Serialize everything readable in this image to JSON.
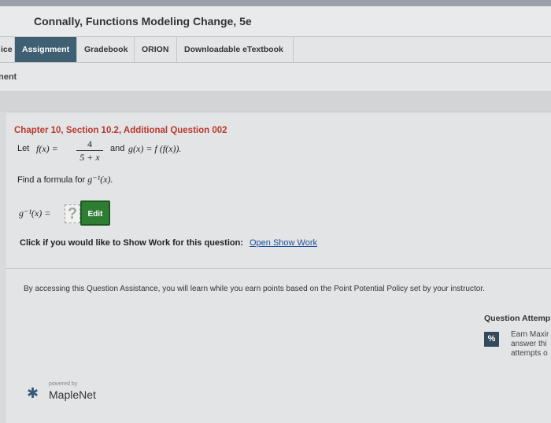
{
  "header": {
    "title": "Connally, Functions Modeling Change, 5e"
  },
  "tabs": [
    {
      "label": "ice"
    },
    {
      "label": "Assignment"
    },
    {
      "label": "Gradebook"
    },
    {
      "label": "ORION"
    },
    {
      "label": "Downloadable eTextbook"
    }
  ],
  "breadcrumb": {
    "label": "nent"
  },
  "question": {
    "heading": "Chapter 10, Section 10.2, Additional Question 002",
    "let_word": "Let",
    "f_def": "f(x) =",
    "numerator": "4",
    "denominator": "5 + x",
    "and_word": "and",
    "g_def": "g(x) = f (f(x)).",
    "prompt": "Find a formula for",
    "ginv": "g⁻¹(x).",
    "answer_lhs": "g⁻¹(x) =",
    "answer_placeholder": "?",
    "edit_label": "Edit",
    "showwork_text": "Click if you would like to Show Work for this question:",
    "showwork_link": "Open Show Work"
  },
  "assistance": {
    "text": "By accessing this Question Assistance, you will learn while you earn points based on the Point Potential Policy set by your instructor."
  },
  "attempts": {
    "title": "Question Attemp",
    "icon_text": "%",
    "line1": "Earn Maxir",
    "line2": "answer thi",
    "line3": "attempts o"
  },
  "branding": {
    "powered_by": "powered by",
    "name": "MapleNet"
  },
  "colors": {
    "active_tab": "#3f5f73",
    "heading_red": "#b8392f",
    "edit_green": "#2e7d32",
    "link_blue": "#1d4f9c"
  }
}
